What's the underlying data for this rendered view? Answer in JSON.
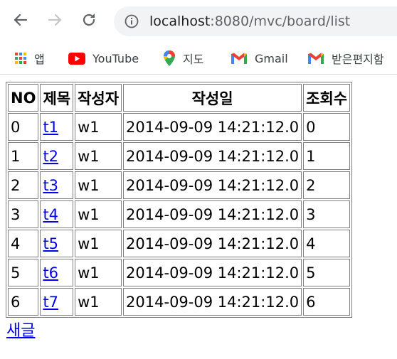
{
  "browser": {
    "url_host": "localhost",
    "url_path": ":8080/mvc/board/list",
    "bookmarks": [
      {
        "label": "앱",
        "icon": "apps-grid-icon"
      },
      {
        "label": "YouTube",
        "icon": "youtube-icon"
      },
      {
        "label": "지도",
        "icon": "maps-pin-icon"
      },
      {
        "label": "Gmail",
        "icon": "gmail-icon"
      },
      {
        "label": "받은편지함",
        "icon": "gmail-icon"
      }
    ]
  },
  "board": {
    "headers": [
      "NO",
      "제목",
      "작성자",
      "작성일",
      "조회수"
    ],
    "rows": [
      {
        "no": "0",
        "title": "t1",
        "writer": "w1",
        "date": "2014-09-09 14:21:12.0",
        "views": "0"
      },
      {
        "no": "1",
        "title": "t2",
        "writer": "w1",
        "date": "2014-09-09 14:21:12.0",
        "views": "1"
      },
      {
        "no": "2",
        "title": "t3",
        "writer": "w1",
        "date": "2014-09-09 14:21:12.0",
        "views": "2"
      },
      {
        "no": "3",
        "title": "t4",
        "writer": "w1",
        "date": "2014-09-09 14:21:12.0",
        "views": "3"
      },
      {
        "no": "4",
        "title": "t5",
        "writer": "w1",
        "date": "2014-09-09 14:21:12.0",
        "views": "4"
      },
      {
        "no": "5",
        "title": "t6",
        "writer": "w1",
        "date": "2014-09-09 14:21:12.0",
        "views": "5"
      },
      {
        "no": "6",
        "title": "t7",
        "writer": "w1",
        "date": "2014-09-09 14:21:12.0",
        "views": "6"
      }
    ],
    "new_post_label": "새글"
  },
  "colors": {
    "link": "#0000ee",
    "youtube_red": "#ff0000",
    "omnibox_bg": "#f1f3f4"
  }
}
